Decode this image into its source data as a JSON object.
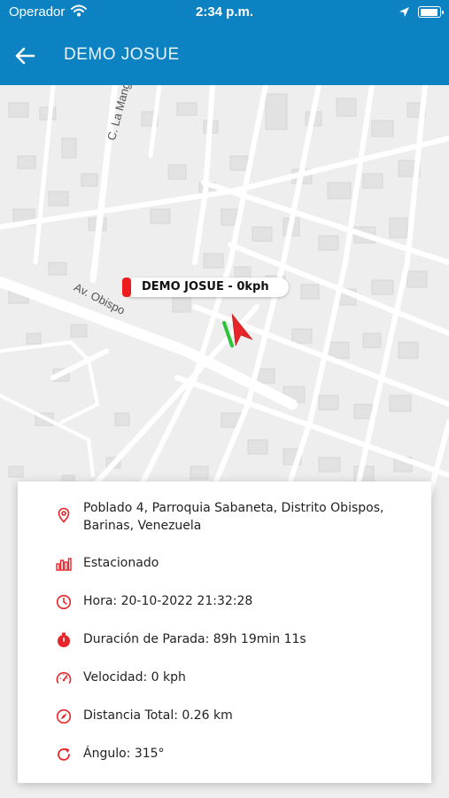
{
  "status_bar": {
    "carrier": "Operador",
    "time": "2:34 p.m.",
    "battery_level": 0.95
  },
  "app_bar": {
    "title": "DEMO JOSUE"
  },
  "map": {
    "street_labels": {
      "la_manga": "C. La Manga",
      "obispo": "Av. Obispo"
    },
    "vehicle_label": "DEMO JOSUE - 0kph",
    "vehicle_heading_deg": 315
  },
  "details": {
    "address": "Poblado 4, Parroquia Sabaneta, Distrito Obispos, Barinas, Venezuela",
    "status": "Estacionado",
    "time": "Hora: 20-10-2022 21:32:28",
    "stop_duration": "Duración de Parada: 89h 19min 11s",
    "speed": "Velocidad: 0 kph",
    "total_distance": "Distancia Total: 0.26 km",
    "angle": "Ángulo: 315°"
  },
  "colors": {
    "app_bar": "#0c82c2",
    "accent_red": "#e8242b",
    "track_green": "#2cc33a"
  }
}
